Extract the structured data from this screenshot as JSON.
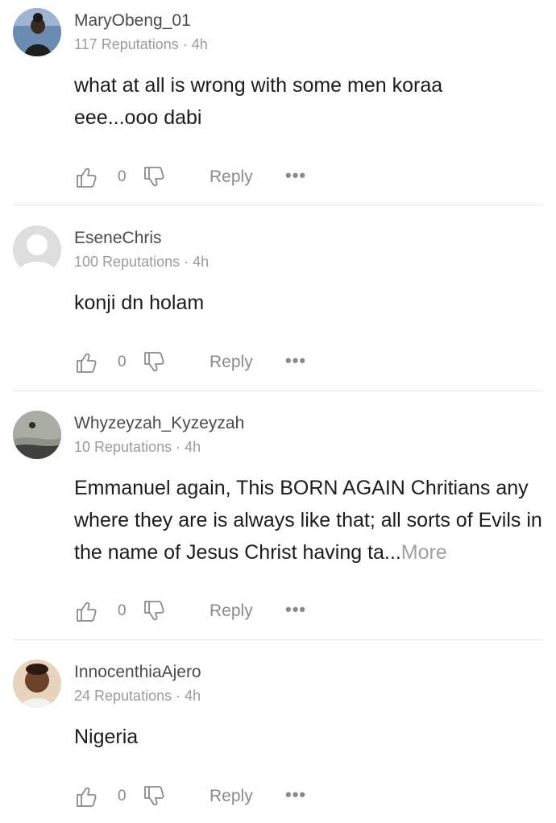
{
  "comments": [
    {
      "username": "MaryObeng_01",
      "meta": "117 Reputations · 4h",
      "text": "what at all is wrong with some men koraa eee...ooo dabi",
      "more": "",
      "like_count": "0",
      "reply_label": "Reply",
      "avatar": "photo-avatar",
      "avatar_colors": [
        "#5b7fa8",
        "#2a2a2a"
      ]
    },
    {
      "username": "EseneChris",
      "meta": "100 Reputations · 4h",
      "text": "konji dn holam",
      "more": "",
      "like_count": "0",
      "reply_label": "Reply",
      "avatar": "default-user-avatar",
      "avatar_colors": [
        "#dcdcdc",
        "#ffffff"
      ]
    },
    {
      "username": "Whyzeyzah_Kyzeyzah",
      "meta": "10 Reputations · 4h",
      "text": "Emmanuel again, This BORN AGAIN Chritians any where they are is always like that; all sorts of Evils in the name of Jesus Christ having ta...",
      "more": "More",
      "like_count": "0",
      "reply_label": "Reply",
      "avatar": "photo-avatar",
      "avatar_colors": [
        "#7a7f76",
        "#3b3d38"
      ]
    },
    {
      "username": "InnocenthiaAjero",
      "meta": "24 Reputations · 4h",
      "text": "Nigeria",
      "more": "",
      "like_count": "0",
      "reply_label": "Reply",
      "avatar": "photo-avatar",
      "avatar_colors": [
        "#e2c8a8",
        "#5a3a26"
      ]
    }
  ],
  "icons": {
    "like": "thumbs-up-icon",
    "dislike": "thumbs-down-icon",
    "more": "more-dots-icon"
  },
  "more_dots": "•••"
}
